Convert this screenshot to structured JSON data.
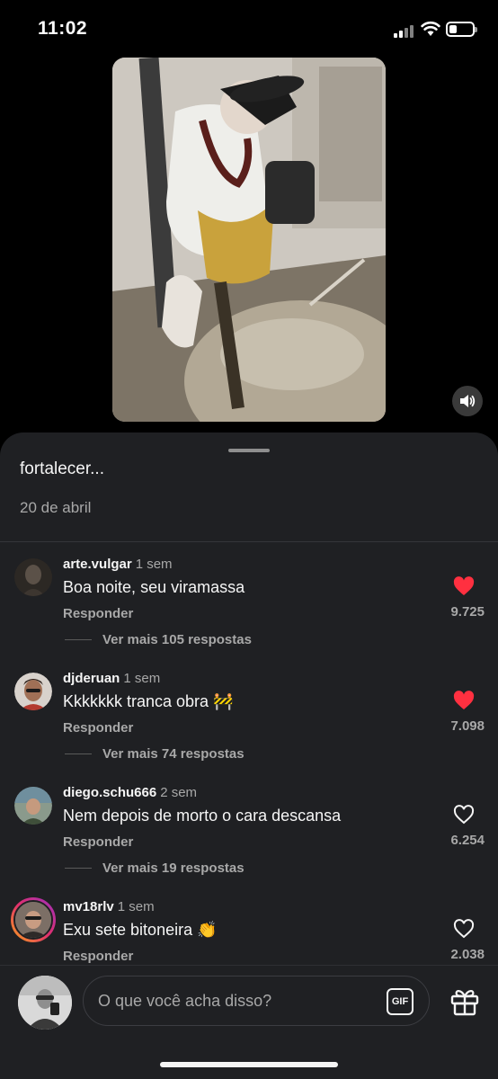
{
  "status_bar": {
    "time": "11:02"
  },
  "post": {
    "caption_tail": "fortalecer...",
    "date": "20 de abril"
  },
  "comments": [
    {
      "username": "arte.vulgar",
      "age": "1 sem",
      "text": "Boa noite, seu viramassa",
      "reply": "Responder",
      "more": "Ver mais 105 respostas",
      "likes": "9.725",
      "liked": true
    },
    {
      "username": "djderuan",
      "age": "1 sem",
      "text": "Kkkkkkk tranca obra 🚧",
      "reply": "Responder",
      "more": "Ver mais 74 respostas",
      "likes": "7.098",
      "liked": true
    },
    {
      "username": "diego.schu666",
      "age": "2 sem",
      "text": "Nem depois de morto o cara descansa",
      "reply": "Responder",
      "more": "Ver mais 19 respostas",
      "likes": "6.254",
      "liked": false
    },
    {
      "username": "mv18rlv",
      "age": "1 sem",
      "text": "Exu sete bitoneira 👏",
      "reply": "Responder",
      "more": "",
      "likes": "2.038",
      "liked": false
    }
  ],
  "composer": {
    "placeholder": "O que você acha disso?",
    "gif_label": "GIF"
  },
  "icons": {
    "mute": "speaker-icon",
    "heart_filled": "heart-filled-icon",
    "heart_outline": "heart-outline-icon",
    "gift": "gift-icon"
  },
  "colors": {
    "sheet_bg": "#1f2023",
    "like_red": "#ff3040",
    "secondary_text": "#a8a8a8"
  }
}
